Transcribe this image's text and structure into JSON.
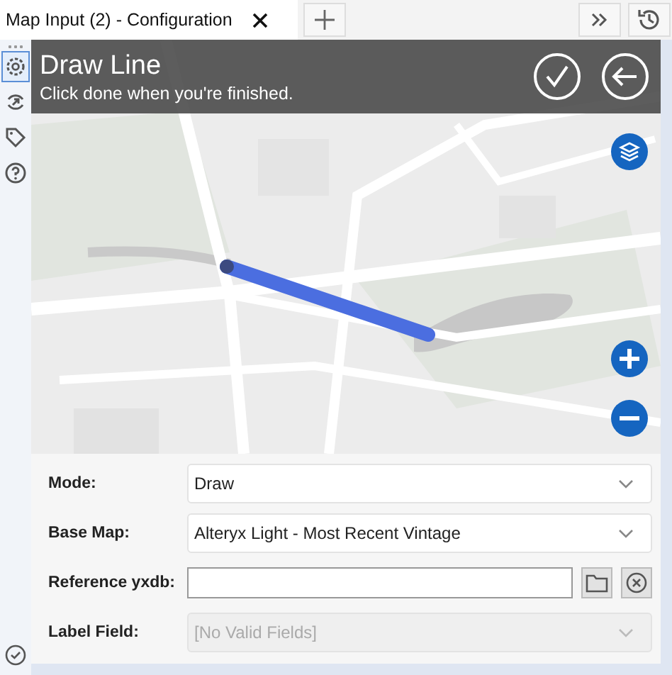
{
  "tabs": [
    {
      "label": "Map Input (2) - Configuration",
      "selected": true
    }
  ],
  "sidebar": {
    "items": [
      {
        "selected": true
      },
      {
        "selected": false
      },
      {
        "selected": false
      },
      {
        "selected": false
      }
    ]
  },
  "map": {
    "kind": "picture",
    "overlay": {
      "title": "Draw Line",
      "subtitle": "Click done when you're finished."
    }
  },
  "form": {
    "fields": [
      {
        "kind": "select",
        "label": "Mode:",
        "value": "Draw",
        "disabled": false
      },
      {
        "kind": "select",
        "label": "Base Map:",
        "value": "Alteryx Light - Most Recent Vintage",
        "disabled": false
      },
      {
        "kind": "file",
        "label": "Reference yxdb:",
        "disabled": false
      },
      {
        "kind": "select",
        "label": "Label Field:",
        "value": "[No Valid Fields]",
        "disabled": true
      }
    ]
  }
}
